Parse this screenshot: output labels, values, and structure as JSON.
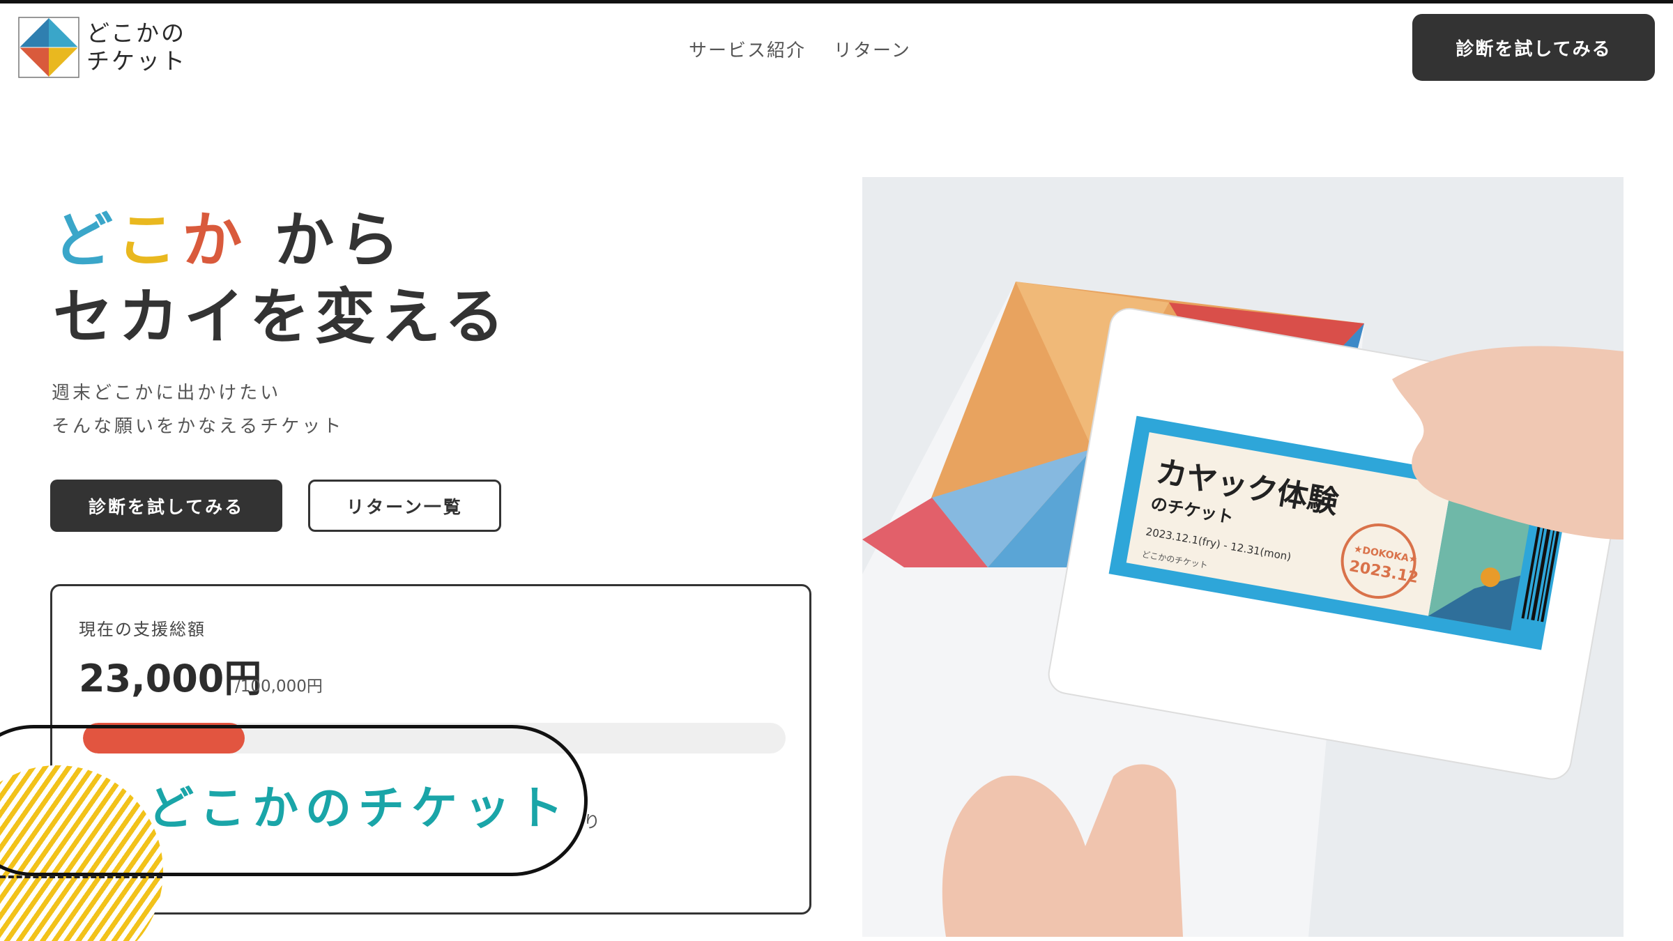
{
  "header": {
    "logo_line1": "どこかの",
    "logo_line2": "チケット",
    "nav": [
      "サービス紹介",
      "リターン"
    ],
    "cta": "診断を試してみる"
  },
  "hero": {
    "title_part1": "ど",
    "title_part2": "こ",
    "title_part3": "か",
    "title_rest_line1": " から",
    "title_line2": "セカイを変える",
    "subtitle_line1": "週末どこかに出かけたい",
    "subtitle_line2": "そんな願いをかなえるチケット",
    "primary_button": "診断を試してみる",
    "secondary_button": "リターン一覧"
  },
  "support": {
    "label": "現在の支援総額",
    "amount": "23,000円",
    "goal": "/100,000円",
    "progress_fraction": 0.23,
    "cut_text": "り"
  },
  "overlay": {
    "title": "どこかのチケット"
  },
  "photo": {
    "ticket_title": "カヤック体験",
    "ticket_subtitle": "のチケット",
    "ticket_dates": "2023.12.1(fry) - 12.31(mon)",
    "stamp_top": "★DOKOKA★",
    "stamp_date": "2023.12",
    "ticket_brand": "どこかのチケット"
  },
  "colors": {
    "accent_blue": "#3aa6c9",
    "accent_yellow": "#e9b81f",
    "accent_red": "#d95a3c",
    "dark": "#333333",
    "teal": "#1aa5a8"
  }
}
